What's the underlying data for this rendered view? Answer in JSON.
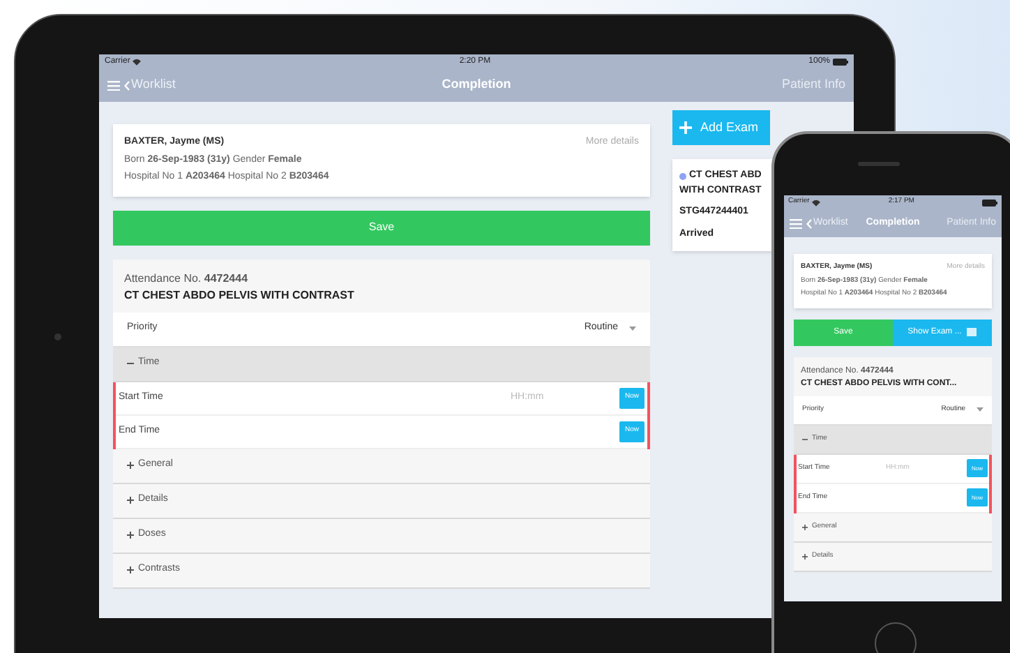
{
  "tablet": {
    "status_bar": {
      "carrier": "Carrier",
      "time": "2:20 PM",
      "battery": "100%"
    },
    "nav": {
      "back": "Worklist",
      "title": "Completion",
      "right": "Patient Info"
    },
    "patient": {
      "name": "BAXTER, Jayme (MS)",
      "more": "More details",
      "born": "Born **26-Sep-1983 (31y)** Gender **Female**",
      "hospital": "Hospital No 1 **A203464** Hospital No 2 **B203464**"
    },
    "save": "Save",
    "exam": {
      "attendance": "Attendance No. **4472444**",
      "title": "CT CHEST ABDO PELVIS WITH CONTRAST"
    },
    "priority": {
      "label": "Priority",
      "value": "Routine"
    },
    "sections": [
      {
        "label": "Time",
        "expanded": true,
        "fields": [
          {
            "label": "Start Time",
            "placeholder": "HH:mm",
            "button": "Now"
          },
          {
            "label": "End Time",
            "button": "Now"
          }
        ]
      },
      {
        "label": "General",
        "expanded": false
      },
      {
        "label": "Details",
        "expanded": false
      },
      {
        "label": "Doses",
        "expanded": false
      },
      {
        "label": "Contrasts",
        "expanded": false
      }
    ],
    "side": {
      "add": "Add Exam",
      "card": {
        "title": "CT CHEST ABD",
        "line2": "WITH CONTRAST",
        "code": "STG447244401",
        "status": "Arrived",
        "color": "#8fa3f2"
      }
    }
  },
  "phone": {
    "status_bar": {
      "carrier": "Carrier",
      "time": "2:17 PM"
    },
    "nav": {
      "back": "Worklist",
      "title": "Completion",
      "right": "Patient Info"
    },
    "patient": {
      "name": "BAXTER, Jayme (MS)",
      "more": "More details",
      "born": "Born **26-Sep-1983 (31y)** Gender **Female**",
      "hospital": "Hospital No 1 **A203464** Hospital No 2 **B203464**"
    },
    "save": "Save",
    "show_exam": "Show Exam ...",
    "exam": {
      "attendance": "Attendance No. **4472444**",
      "title": "CT CHEST ABDO PELVIS WITH CONT..."
    },
    "priority": {
      "label": "Priority",
      "value": "Routine"
    },
    "sections": [
      {
        "label": "Time",
        "expanded": true,
        "fields": [
          {
            "label": "Start Time",
            "placeholder": "HH:mm",
            "button": "Now"
          },
          {
            "label": "End Time",
            "button": "Now"
          }
        ]
      },
      {
        "label": "General",
        "expanded": false
      },
      {
        "label": "Details",
        "expanded": false
      }
    ]
  }
}
